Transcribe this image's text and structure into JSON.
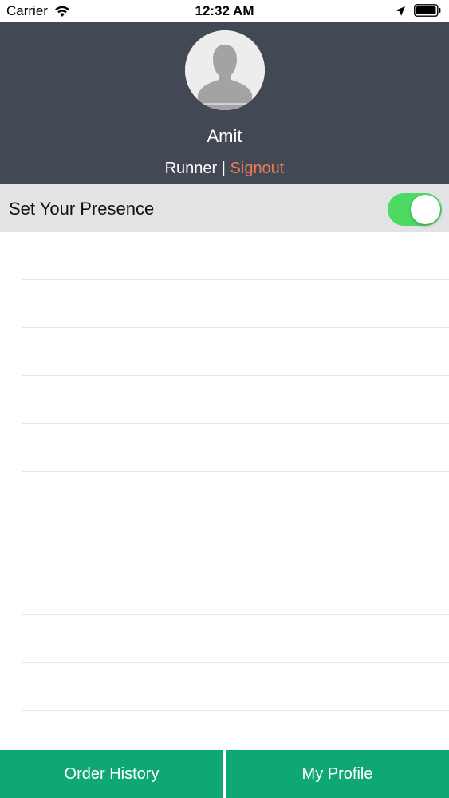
{
  "status_bar": {
    "carrier": "Carrier",
    "time": "12:32 AM"
  },
  "profile": {
    "name": "Amit",
    "role": "Runner",
    "separator": " | ",
    "signout_label": "Signout"
  },
  "presence": {
    "label": "Set Your Presence",
    "enabled": true
  },
  "list": {
    "rows": [
      "",
      "",
      "",
      "",
      "",
      "",
      "",
      "",
      "",
      ""
    ]
  },
  "bottom_bar": {
    "order_history_label": "Order History",
    "my_profile_label": "My Profile"
  },
  "colors": {
    "header_bg": "#434855",
    "accent_signout": "#f07a54",
    "toggle_on": "#4cd964",
    "bottom_bar": "#0fa872"
  }
}
